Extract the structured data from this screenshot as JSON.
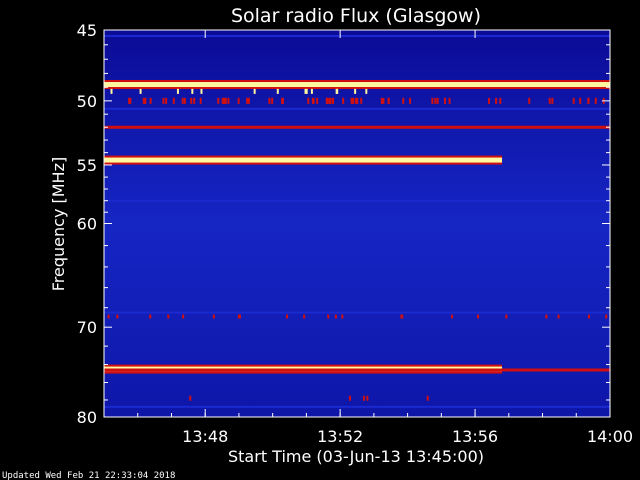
{
  "chart_data": {
    "type": "heatmap",
    "title": "Solar radio Flux (Glasgow)",
    "xlabel": "Start Time (03-Jun-13 13:45:00)",
    "ylabel": "Frequency [MHz]",
    "x_range_minutes": [
      0,
      15
    ],
    "x_ticks": [
      {
        "minute": 3,
        "label": "13:48"
      },
      {
        "minute": 7,
        "label": "13:52"
      },
      {
        "minute": 11,
        "label": "13:56"
      },
      {
        "minute": 15,
        "label": "14:00"
      }
    ],
    "ylim": [
      45,
      80
    ],
    "y_scale": "log",
    "y_ticks": [
      45,
      50,
      55,
      60,
      70,
      80
    ],
    "footer": "Updated Wed Feb 21 22:33:04 2018",
    "colors": {
      "background": "#000000",
      "low": "#0a0a90",
      "mid": "#1a2ad0",
      "high": "#d01010",
      "peak": "#fff8a0"
    },
    "bands": [
      {
        "freq": 45.4,
        "level": "mid",
        "x_end_minute": 15
      },
      {
        "freq": 48.8,
        "level": "peak",
        "x_end_minute": 15
      },
      {
        "freq": 50.6,
        "level": "mid",
        "x_end_minute": 15
      },
      {
        "freq": 52.0,
        "level": "high",
        "x_end_minute": 15
      },
      {
        "freq": 54.6,
        "level": "peak",
        "x_end_minute": 11.8
      },
      {
        "freq": 58.0,
        "level": "mid",
        "x_end_minute": 15
      },
      {
        "freq": 68.5,
        "level": "mid",
        "x_end_minute": 15
      },
      {
        "freq": 74.5,
        "level": "peak",
        "x_end_minute": 11.8
      },
      {
        "freq": 74.6,
        "level": "high",
        "x_end_minute": 15
      },
      {
        "freq": 78.8,
        "level": "mid",
        "x_end_minute": 15
      }
    ]
  }
}
